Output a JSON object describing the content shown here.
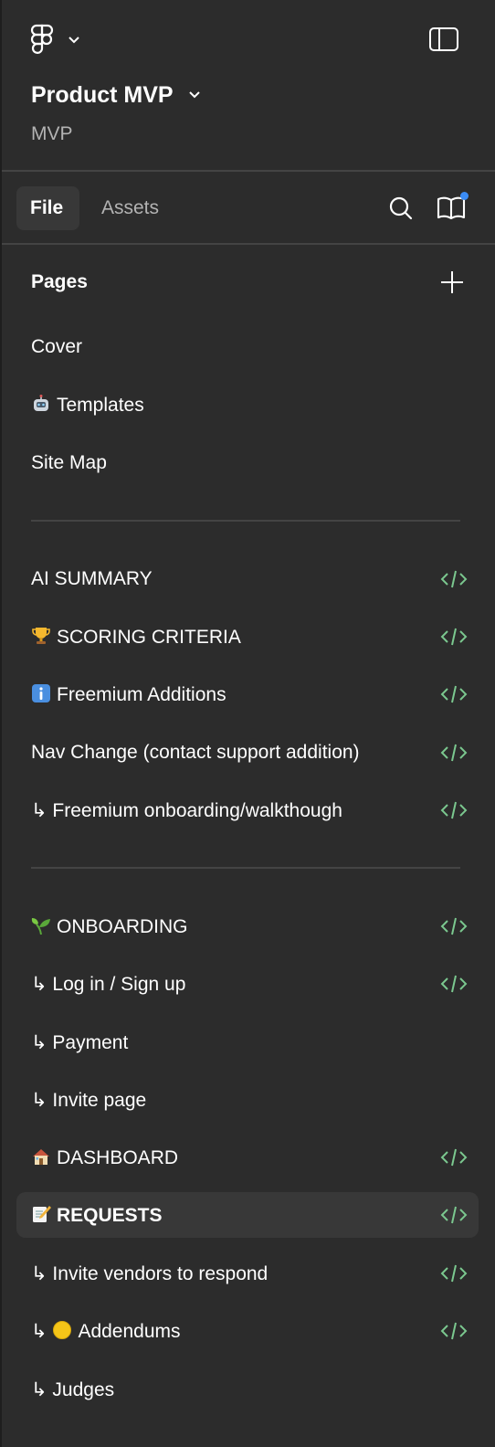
{
  "header": {
    "project_title": "Product MVP",
    "subtitle": "MVP"
  },
  "tabs": {
    "file": "File",
    "assets": "Assets"
  },
  "pages_section": {
    "title": "Pages"
  },
  "pages": [
    {
      "label": "Cover",
      "icon": null,
      "dev": false
    },
    {
      "label": "Templates",
      "icon": "robot-emoji",
      "dev": false
    },
    {
      "label": "Site Map",
      "icon": null,
      "dev": false
    },
    {
      "label": "AI SUMMARY",
      "icon": null,
      "dev": true
    },
    {
      "label": "SCORING CRITERIA",
      "icon": "trophy-emoji",
      "dev": true
    },
    {
      "label": "Freemium Additions",
      "icon": "info-emoji",
      "dev": true
    },
    {
      "label": "Nav Change (contact support addition)",
      "icon": null,
      "dev": true
    },
    {
      "label": "↳ Freemium onboarding/walkthough",
      "icon": null,
      "dev": true
    },
    {
      "label": "ONBOARDING",
      "icon": "seedling-emoji",
      "dev": true
    },
    {
      "label": "↳ Log in / Sign up",
      "icon": null,
      "dev": true
    },
    {
      "label": "↳ Payment",
      "icon": null,
      "dev": false
    },
    {
      "label": "↳ Invite page",
      "icon": null,
      "dev": false
    },
    {
      "label": "DASHBOARD",
      "icon": "house-emoji",
      "dev": true
    },
    {
      "label": "REQUESTS",
      "icon": "memo-emoji",
      "dev": true,
      "selected": true
    },
    {
      "label": "↳ Invite vendors to respond",
      "icon": null,
      "dev": true
    },
    {
      "label": "Addendums",
      "prefix": "↳ ",
      "icon": "yellow-circle-emoji",
      "dev": true
    },
    {
      "label": "↳ Judges",
      "icon": null,
      "dev": false
    }
  ],
  "colors": {
    "background": "#2c2c2c",
    "selected": "#383838",
    "dev_mode_green": "#7bc88f",
    "notification_dot": "#3b8cf5"
  }
}
